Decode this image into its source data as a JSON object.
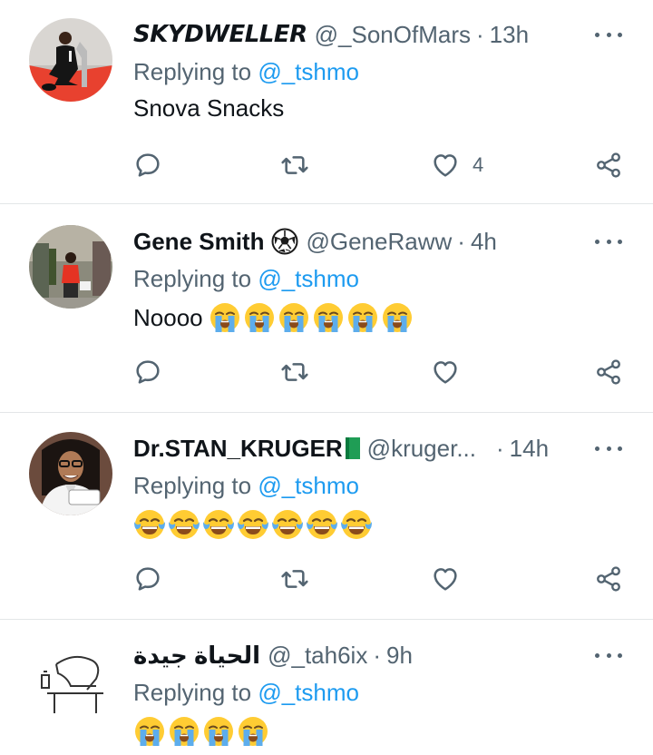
{
  "colors": {
    "text": "#0f1419",
    "secondary": "#536471",
    "link": "#1d9bf0",
    "divider": "#e3e6e8"
  },
  "replying_prefix": "Replying to",
  "tweets": [
    {
      "name": "SKYDWELLER",
      "handle": "@_SonOfMars",
      "time": "13h",
      "mention": "@_tshmo",
      "text": "Snova Snacks",
      "like_count": "4",
      "icons": [
        "reply-icon",
        "retweet-icon",
        "like-icon",
        "share-icon",
        "more-icon"
      ]
    },
    {
      "name": "Gene Smith",
      "handle": "@GeneRaww",
      "time": "4h",
      "mention": "@_tshmo",
      "text": "Noooo",
      "emoji": [
        "loudly-crying-face",
        "loudly-crying-face",
        "loudly-crying-face",
        "loudly-crying-face",
        "loudly-crying-face",
        "loudly-crying-face"
      ],
      "like_count": ""
    },
    {
      "name": "Dr.STAN_KRUGER",
      "handle": "@kruger...",
      "time": "14h",
      "mention": "@_tshmo",
      "text": "",
      "emoji": [
        "tears-of-joy-face",
        "tears-of-joy-face",
        "tears-of-joy-face",
        "tears-of-joy-face",
        "tears-of-joy-face",
        "tears-of-joy-face",
        "tears-of-joy-face"
      ],
      "like_count": ""
    },
    {
      "name": "الحياة جيدة",
      "handle": "@_tah6ix",
      "time": "9h",
      "mention": "@_tshmo",
      "text": "",
      "emoji": [
        "loudly-crying-face",
        "loudly-crying-face",
        "loudly-crying-face",
        "loudly-crying-face"
      ],
      "like_count": ""
    }
  ],
  "separator": "·"
}
